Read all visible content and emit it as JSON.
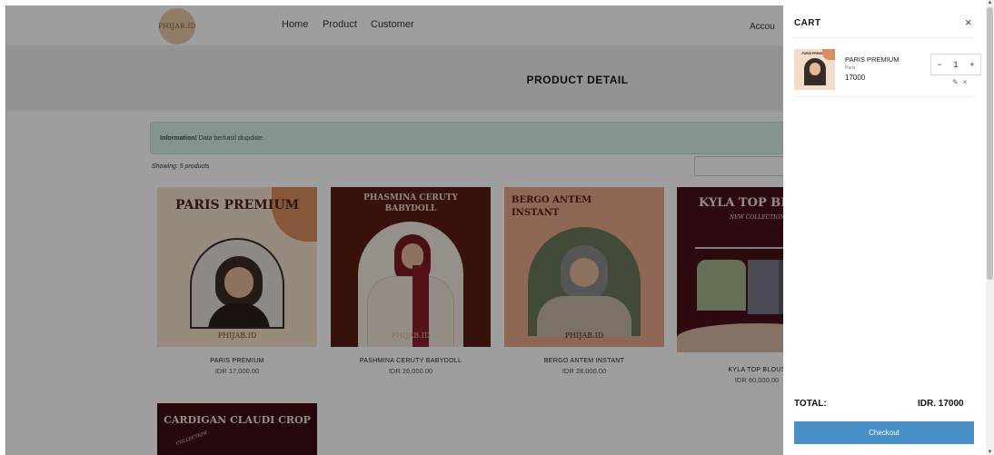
{
  "nav": {
    "logo_text": "PHIJAB.ID",
    "links": [
      "Home",
      "Product",
      "Customer"
    ],
    "account": "Accou"
  },
  "banner": {
    "title": "PRODUCT DETAIL"
  },
  "alert": {
    "strong": "Information!",
    "message": " Data berhasil diupdate."
  },
  "showing": "Showing: 5 products",
  "products": [
    {
      "thumb_title": "PARIS PREMIUM",
      "thumb_foot": "PHIJAB.ID",
      "name": "PARIS PREMIUM",
      "price": "IDR 17,000.00"
    },
    {
      "thumb_title": "PHASMINA CERUTY BABYDOLL",
      "thumb_foot": "PHIJAB.ID",
      "name": "PASHMINA CERUTY BABYDOLL",
      "price": "IDR 26,000.00"
    },
    {
      "thumb_title": "BERGO ANTEM INSTANT",
      "thumb_foot": "PHIJAB.ID",
      "name": "BERGO ANTEM INSTANT",
      "price": "IDR 28,000.00"
    },
    {
      "thumb_title": "KYLA TOP BL",
      "thumb_sub": "NEW COLLECTION",
      "name": "KYLA TOP BLOUS",
      "price": "IDR 60,000.00"
    },
    {
      "thumb_title": "CARDIGAN CLAUDI CROP",
      "thumb_sub": "COLLECTION"
    }
  ],
  "cart": {
    "title": "CART",
    "close": "×",
    "item": {
      "thumb_text": "PARIS PREMIUM",
      "name": "PARIS PREMIUM",
      "brand": "Paris",
      "price": "17000",
      "qty": "1",
      "minus": "−",
      "plus": "+",
      "edit": "✎",
      "remove": "×"
    },
    "total_label": "TOTAL:",
    "total_value": "IDR. 17000",
    "checkout": "Checkout"
  },
  "colors": {
    "accent": "#4a90c8",
    "alert_bg": "#d7efe3",
    "logo_bg": "#e7c9a6"
  }
}
